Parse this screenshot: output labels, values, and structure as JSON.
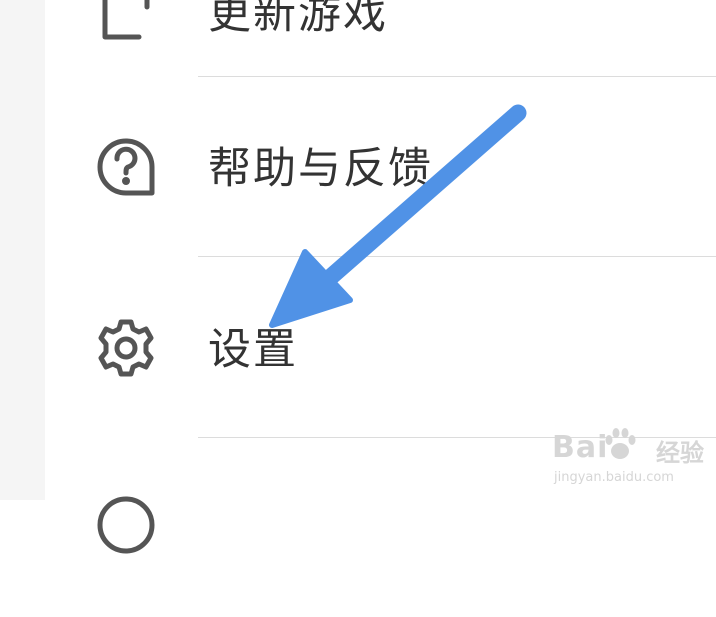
{
  "menu": {
    "items": [
      {
        "label": "更新游戏",
        "icon": "update-icon"
      },
      {
        "label": "帮助与反馈",
        "icon": "help-feedback-icon"
      },
      {
        "label": "设置",
        "icon": "gear-icon"
      },
      {
        "label": "",
        "icon": "partial-icon"
      }
    ]
  },
  "annotation": {
    "arrow_color": "#5092e6",
    "target": "设置"
  },
  "watermark": {
    "brand": "Bai",
    "brand_cn": "经验",
    "url": "jingyan.baidu.com"
  },
  "colors": {
    "icon": "#555555",
    "text": "#333333",
    "divider": "#dcdcdc",
    "sidebar": "#f5f5f5"
  }
}
